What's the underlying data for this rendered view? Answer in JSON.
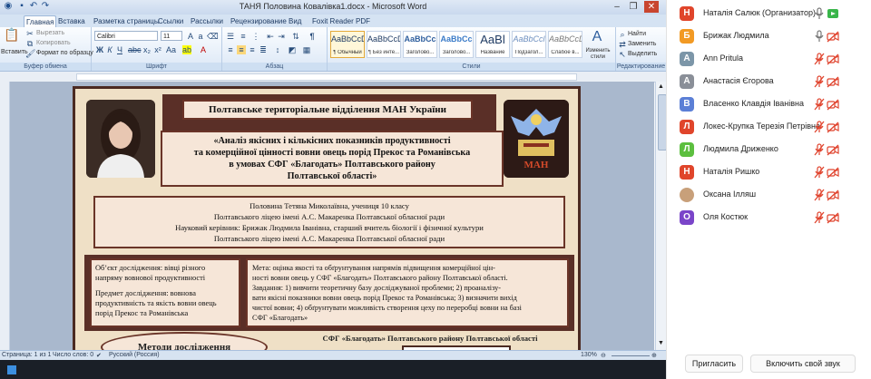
{
  "word": {
    "app_title": "ТАНЯ Половина Ковалівка1.docx - Microsoft Word",
    "tabs": [
      "Главная",
      "Вставка",
      "Разметка страницы",
      "Ссылки",
      "Рассылки",
      "Рецензирование",
      "Вид",
      "Foxit Reader PDF"
    ],
    "active_tab": "Главная",
    "clipboard": {
      "paste": "Вставить",
      "cut": "Вырезать",
      "copy": "Копировать",
      "format_painter": "Формат по образцу",
      "label": "Буфер обмена"
    },
    "font": {
      "name": "Calibri",
      "size": "11",
      "label": "Шрифт"
    },
    "paragraph_label": "Абзац",
    "styles": {
      "items": [
        {
          "preview": "AaBbCcDc",
          "name": "¶ Обычный"
        },
        {
          "preview": "AaBbCcDc",
          "name": "¶ Без инте..."
        },
        {
          "preview": "AaBbCc",
          "name": "Заголово..."
        },
        {
          "preview": "AaBbCc",
          "name": "Заголово..."
        },
        {
          "preview": "AaBl",
          "name": "Название"
        },
        {
          "preview": "AaBbCcl",
          "name": "Подзагол..."
        },
        {
          "preview": "AaBbCcDc",
          "name": "Слабое в..."
        }
      ],
      "change_styles": "Изменить стили",
      "label": "Стили"
    },
    "editing": {
      "find": "Найти",
      "replace": "Заменить",
      "select": "Выделить",
      "label": "Редактирование"
    },
    "status": {
      "page": "Страница: 1 из 1",
      "words": "Число слов: 0",
      "language": "Русский (Россия)",
      "zoom": "130%"
    }
  },
  "poster": {
    "header": "Полтавське територіальне відділення МАН України",
    "title_lines": [
      "«Аналіз якісних і кількісних показників продуктивності",
      "та комерційної цінності вовни овець порід Прекос та Романівська",
      "в умовах СФГ «Благодать» Полтавського району",
      "Полтавської області»"
    ],
    "author_lines": [
      "Половина Тетяна Миколаївна,   учениця  10 класу",
      "Полтавського  ліцею імені  А.С. Макаренка  Полтавської  обласної ради",
      "Науковий керівник: Брижак Людмила Іванівна, старший вчитель біології і фізичної культури",
      "Полтавського  ліцею  імені  А.С. Макаренка Полтавської  обласної ради"
    ],
    "object_lines": [
      "Об’єкт дослідження: вівці різного",
      "напряму вовнової продуктивності",
      "",
      "Предмет дослідження: вовнова",
      "продуктивність та якість вовни овець",
      "порід    Прекос та Романівська"
    ],
    "goal_lines": [
      "Мета: оцінка якості та обґрунтування напрямів підвищення комерційної цін-",
      "ності вовни овець у СФГ «Благодать» Полтавського району Полтавської області.",
      "Завдання: 1) вивчити теоретичну базу досліджуваної проблеми; 2) проаналізу-",
      "вати якісні показники вовни овець порід Прекос та Романівська; 3) визначити вихід",
      "чистої вовни; 4) обґрунтувати можливість створення цеху по переробці вовни на базі",
      "СФГ «Благодать»"
    ],
    "methods": "Методи  дослідження",
    "farm_caption": "СФГ «Благодать» Полтавського району  Полтавської області",
    "logo_text": "МАН"
  },
  "participants": [
    {
      "initial": "Н",
      "name": "Наталія Салюк (Организатор)",
      "color": "#e0452b",
      "mic": "on",
      "video": "on"
    },
    {
      "initial": "Б",
      "name": "Брижак Людмила",
      "color": "#f29a24",
      "mic": "on",
      "video": "off"
    },
    {
      "initial": "A",
      "name": "Ann Pritula",
      "color": "#7c96a8",
      "mic": "muted",
      "video": "off"
    },
    {
      "initial": "А",
      "name": "Анастасія Єгорова",
      "color": "#8a8f98",
      "mic": "muted",
      "video": "off"
    },
    {
      "initial": "В",
      "name": "Власенко Клавдія Іванівна",
      "color": "#5b7fd6",
      "mic": "muted",
      "video": "off"
    },
    {
      "initial": "Л",
      "name": "Локес-Крупка Терезія Петрівна",
      "color": "#e0452b",
      "mic": "muted",
      "video": "off"
    },
    {
      "initial": "Л",
      "name": "Людмила Дриженко",
      "color": "#5cbf3f",
      "mic": "muted",
      "video": "off"
    },
    {
      "initial": "Н",
      "name": "Наталія Ришко",
      "color": "#e0452b",
      "mic": "muted",
      "video": "off"
    },
    {
      "initial": "",
      "name": "Оксана Ілляш",
      "color": "#c8a07a",
      "mic": "muted",
      "video": "off"
    },
    {
      "initial": "О",
      "name": "Оля Костюк",
      "color": "#7a45c9",
      "mic": "muted",
      "video": "off"
    }
  ],
  "zoom_buttons": {
    "invite": "Пригласить",
    "unmute": "Включить свой звук"
  }
}
